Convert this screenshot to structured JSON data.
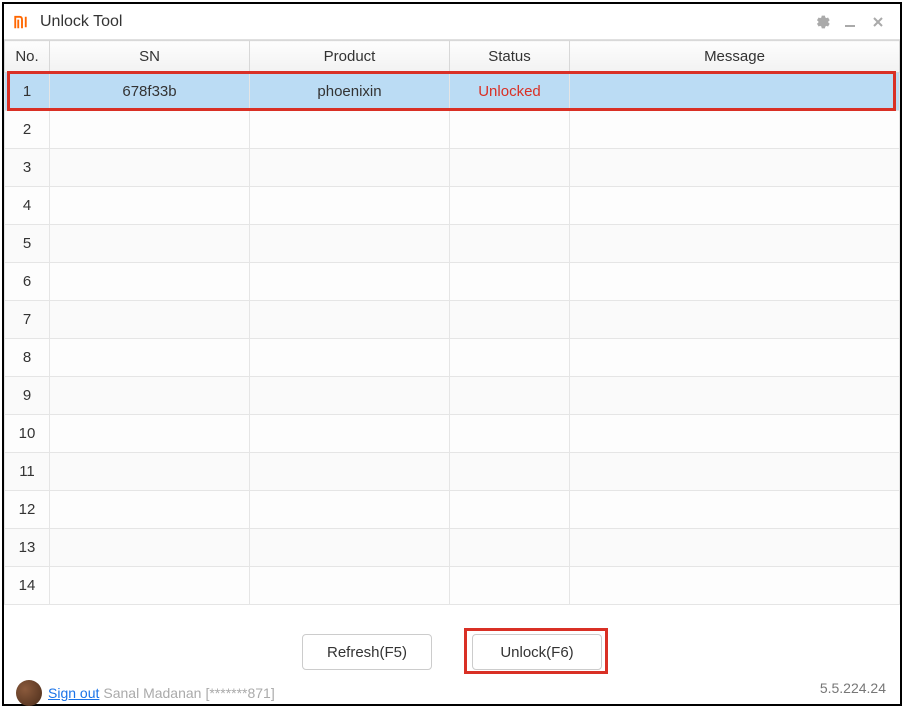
{
  "window": {
    "title": "Unlock Tool"
  },
  "table": {
    "columns": {
      "no": "No.",
      "sn": "SN",
      "product": "Product",
      "status": "Status",
      "message": "Message"
    },
    "rows": [
      {
        "no": "1",
        "sn": "678f33b",
        "product": "phoenixin",
        "status": "Unlocked",
        "message": "",
        "selected": true,
        "status_red": true
      },
      {
        "no": "2",
        "sn": "",
        "product": "",
        "status": "",
        "message": ""
      },
      {
        "no": "3",
        "sn": "",
        "product": "",
        "status": "",
        "message": ""
      },
      {
        "no": "4",
        "sn": "",
        "product": "",
        "status": "",
        "message": ""
      },
      {
        "no": "5",
        "sn": "",
        "product": "",
        "status": "",
        "message": ""
      },
      {
        "no": "6",
        "sn": "",
        "product": "",
        "status": "",
        "message": ""
      },
      {
        "no": "7",
        "sn": "",
        "product": "",
        "status": "",
        "message": ""
      },
      {
        "no": "8",
        "sn": "",
        "product": "",
        "status": "",
        "message": ""
      },
      {
        "no": "9",
        "sn": "",
        "product": "",
        "status": "",
        "message": ""
      },
      {
        "no": "10",
        "sn": "",
        "product": "",
        "status": "",
        "message": ""
      },
      {
        "no": "11",
        "sn": "",
        "product": "",
        "status": "",
        "message": ""
      },
      {
        "no": "12",
        "sn": "",
        "product": "",
        "status": "",
        "message": ""
      },
      {
        "no": "13",
        "sn": "",
        "product": "",
        "status": "",
        "message": ""
      },
      {
        "no": "14",
        "sn": "",
        "product": "",
        "status": "",
        "message": ""
      }
    ]
  },
  "buttons": {
    "refresh": "Refresh(F5)",
    "unlock": "Unlock(F6)"
  },
  "user": {
    "signout": "Sign out",
    "name": "Sanal Madanan",
    "masked": "[*******871]"
  },
  "version": "5.5.224.24"
}
